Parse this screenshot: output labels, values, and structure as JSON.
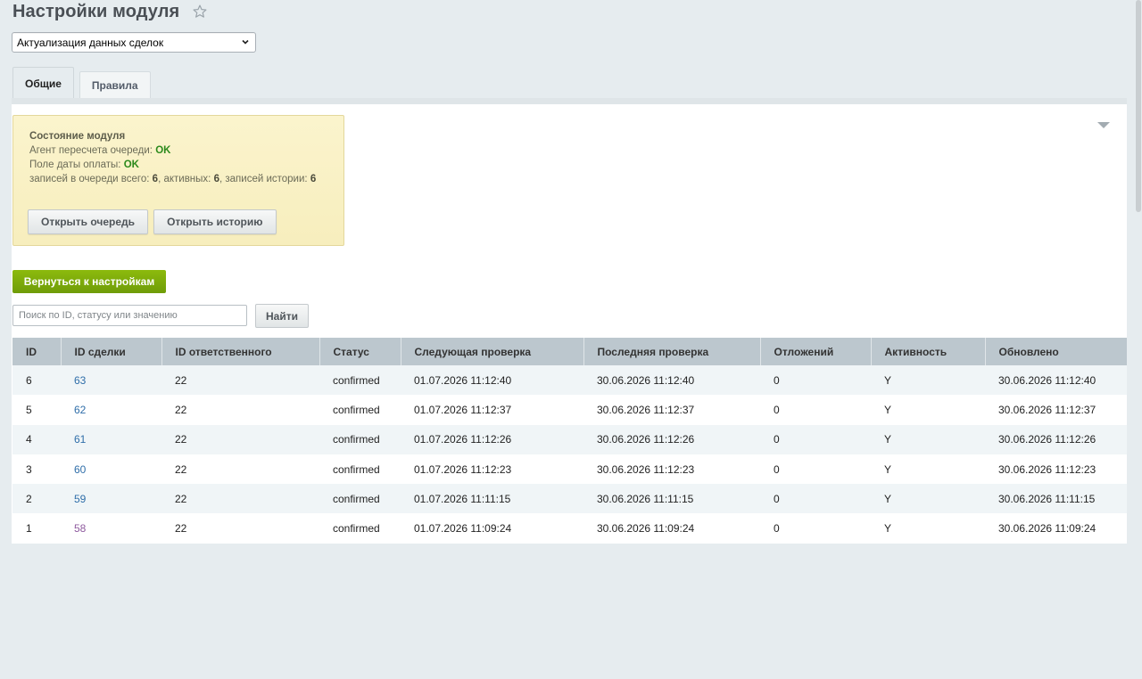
{
  "page": {
    "title": "Настройки модуля",
    "favorite_icon": "star-icon"
  },
  "module_select": {
    "selected": "Актуализация данных сделок"
  },
  "tabs": [
    {
      "label": "Общие",
      "active": true
    },
    {
      "label": "Правила",
      "active": false
    }
  ],
  "status": {
    "title": "Состояние модуля",
    "agent_label": "Агент пересчета очереди:",
    "agent_value": "OK",
    "paydate_label": "Поле даты оплаты:",
    "paydate_value": "OK",
    "queue_prefix": "записей в очереди всего:",
    "queue_total": "6",
    "active_prefix": ", активных:",
    "active_count": "6",
    "history_prefix": ", записей истории:",
    "history_count": "6",
    "open_queue_label": "Открыть очередь",
    "open_history_label": "Открыть историю"
  },
  "actions": {
    "back_label": "Вернуться к настройкам",
    "search_placeholder": "Поиск по ID, статусу или значению",
    "search_button": "Найти"
  },
  "table": {
    "columns": [
      "ID",
      "ID сделки",
      "ID ответственного",
      "Статус",
      "Следующая проверка",
      "Последняя проверка",
      "Отложений",
      "Активность",
      "Обновлено"
    ],
    "rows": [
      {
        "id": "6",
        "deal_id": "63",
        "responsible_id": "22",
        "status": "confirmed",
        "next_check": "01.07.2026 11:12:40",
        "last_check": "30.06.2026 11:12:40",
        "postponed": "0",
        "active": "Y",
        "updated": "30.06.2026 11:12:40"
      },
      {
        "id": "5",
        "deal_id": "62",
        "responsible_id": "22",
        "status": "confirmed",
        "next_check": "01.07.2026 11:12:37",
        "last_check": "30.06.2026 11:12:37",
        "postponed": "0",
        "active": "Y",
        "updated": "30.06.2026 11:12:37"
      },
      {
        "id": "4",
        "deal_id": "61",
        "responsible_id": "22",
        "status": "confirmed",
        "next_check": "01.07.2026 11:12:26",
        "last_check": "30.06.2026 11:12:26",
        "postponed": "0",
        "active": "Y",
        "updated": "30.06.2026 11:12:26"
      },
      {
        "id": "3",
        "deal_id": "60",
        "responsible_id": "22",
        "status": "confirmed",
        "next_check": "01.07.2026 11:12:23",
        "last_check": "30.06.2026 11:12:23",
        "postponed": "0",
        "active": "Y",
        "updated": "30.06.2026 11:12:23"
      },
      {
        "id": "2",
        "deal_id": "59",
        "responsible_id": "22",
        "status": "confirmed",
        "next_check": "01.07.2026 11:11:15",
        "last_check": "30.06.2026 11:11:15",
        "postponed": "0",
        "active": "Y",
        "updated": "30.06.2026 11:11:15"
      },
      {
        "id": "1",
        "deal_id": "58",
        "responsible_id": "22",
        "status": "confirmed",
        "next_check": "01.07.2026 11:09:24",
        "last_check": "30.06.2026 11:09:24",
        "postponed": "0",
        "active": "Y",
        "updated": "30.06.2026 11:09:24"
      }
    ]
  },
  "colors": {
    "ok": "#2c8a1c",
    "link": "#2f6ea9",
    "visited_link": "#8e5a9e",
    "primary_button": "#7aa70a",
    "status_box_bg": "#f9f1c4",
    "grid_header_bg": "#bcc7ce"
  }
}
